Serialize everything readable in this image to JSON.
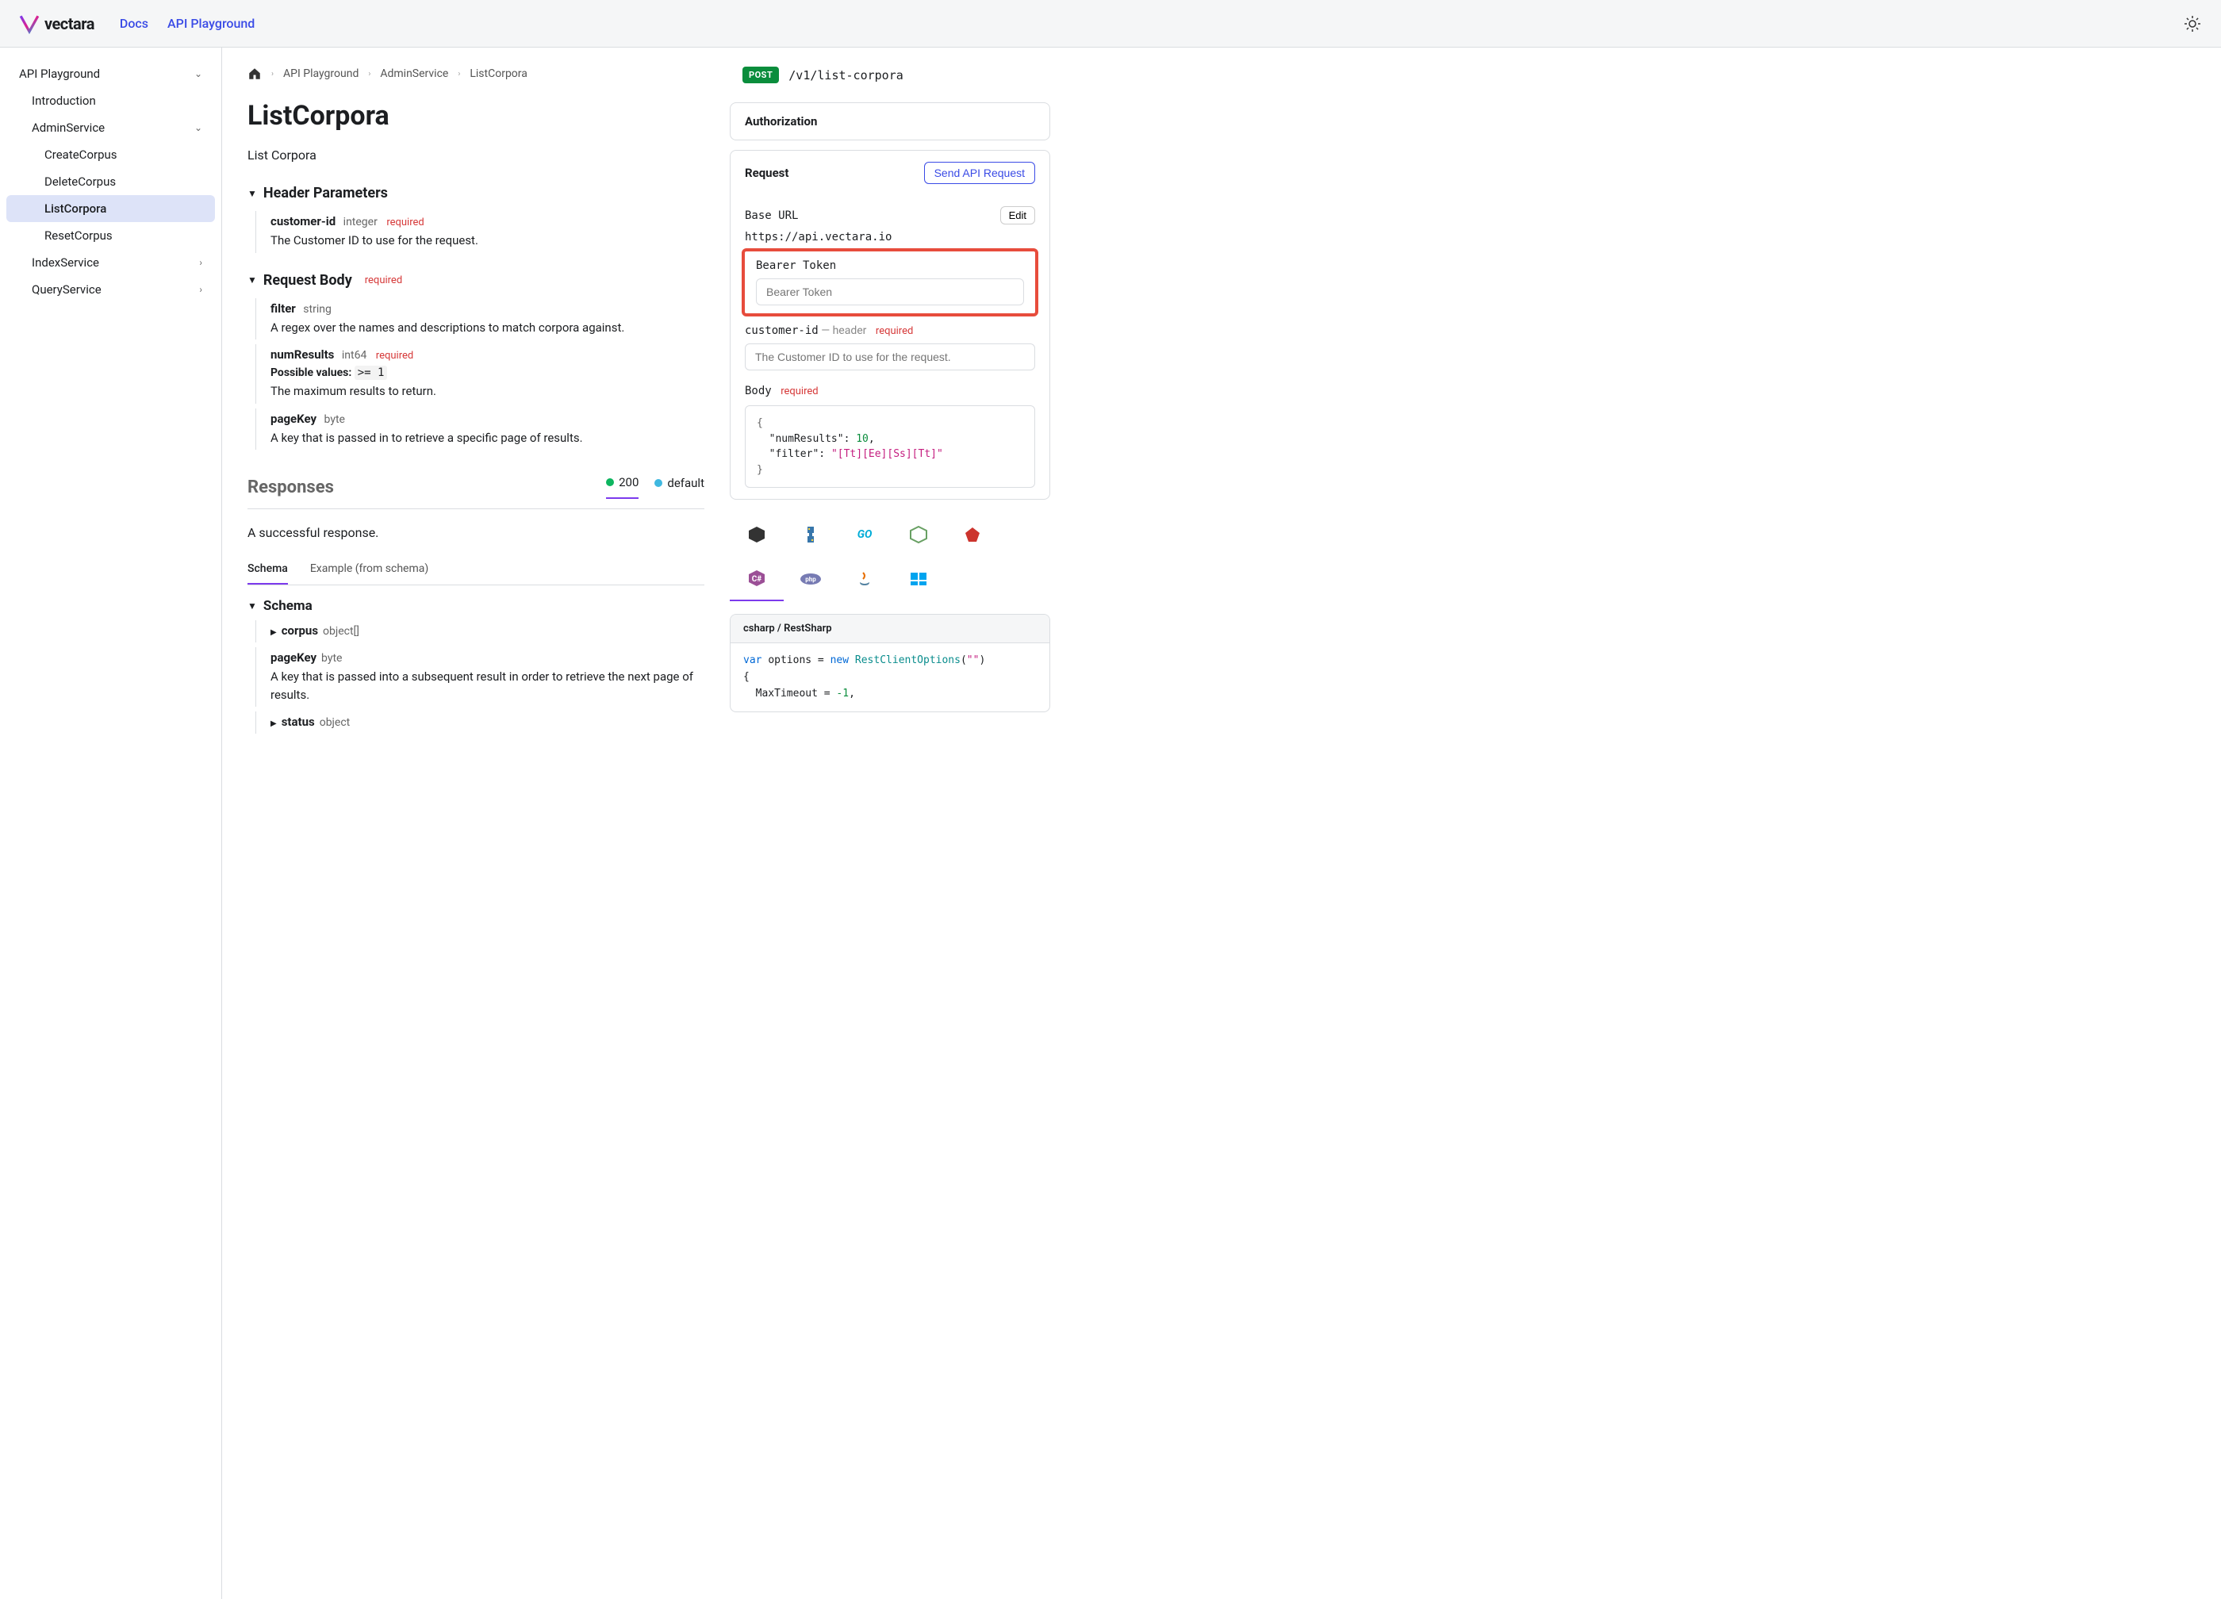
{
  "brand": "vectara",
  "nav": {
    "docs": "Docs",
    "playground": "API Playground"
  },
  "sidebar": {
    "playground": "API Playground",
    "intro": "Introduction",
    "admin": "AdminService",
    "admin_items": {
      "create": "CreateCorpus",
      "delete": "DeleteCorpus",
      "list": "ListCorpora",
      "reset": "ResetCorpus"
    },
    "index": "IndexService",
    "query": "QueryService"
  },
  "breadcrumb": {
    "b1": "API Playground",
    "b2": "AdminService",
    "b3": "ListCorpora"
  },
  "page": {
    "title": "ListCorpora",
    "subtitle": "List Corpora"
  },
  "headerParams": {
    "title": "Header Parameters",
    "customerId": {
      "name": "customer-id",
      "type": "integer",
      "req": "required",
      "desc": "The Customer ID to use for the request."
    }
  },
  "reqBody": {
    "title": "Request Body",
    "req": "required",
    "filter": {
      "name": "filter",
      "type": "string",
      "desc": "A regex over the names and descriptions to match corpora against."
    },
    "numResults": {
      "name": "numResults",
      "type": "int64",
      "req": "required",
      "possibleLabel": "Possible values:",
      "possibleVal": ">= 1",
      "desc": "The maximum results to return."
    },
    "pageKey": {
      "name": "pageKey",
      "type": "byte",
      "desc": "A key that is passed in to retrieve a specific page of results."
    }
  },
  "responses": {
    "title": "Responses",
    "r200": "200",
    "rdefault": "default",
    "successText": "A successful response.",
    "tabSchema": "Schema",
    "tabExample": "Example (from schema)",
    "schemaTitle": "Schema",
    "corpus": {
      "name": "corpus",
      "type": "object[]"
    },
    "pageKey": {
      "name": "pageKey",
      "type": "byte",
      "desc": "A key that is passed into a subsequent result in order to retrieve the next page of results."
    },
    "status": {
      "name": "status",
      "type": "object"
    }
  },
  "endpoint": {
    "method": "POST",
    "path": "/v1/list-corpora"
  },
  "authPanel": {
    "title": "Authorization"
  },
  "reqPanel": {
    "title": "Request",
    "send": "Send API Request",
    "baseUrlLabel": "Base URL",
    "edit": "Edit",
    "baseUrl": "https://api.vectara.io",
    "bearerLabel": "Bearer Token",
    "bearerPlaceholder": "Bearer Token",
    "custLabel": "customer-id",
    "custMeta": " — header",
    "custReq": "required",
    "custPlaceholder": "The Customer ID to use for the request.",
    "bodyLabel": "Body",
    "bodyReq": "required",
    "bodyJson": {
      "open": "{",
      "l1k": "\"numResults\"",
      "l1v": "10",
      "l2k": "\"filter\"",
      "l2v": "\"[Tt][Ee][Ss][Tt]\"",
      "close": "}"
    }
  },
  "codeSample": {
    "header": "csharp / RestSharp",
    "var": "var",
    "options": "options = ",
    "new": "new",
    "cls": "RestClientOptions",
    "paren": "(",
    "empty": "\"\"",
    "paren2": ")",
    "brace": "{",
    "maxTimeout": "  MaxTimeout = ",
    "neg1": "-1",
    "comma": ","
  }
}
